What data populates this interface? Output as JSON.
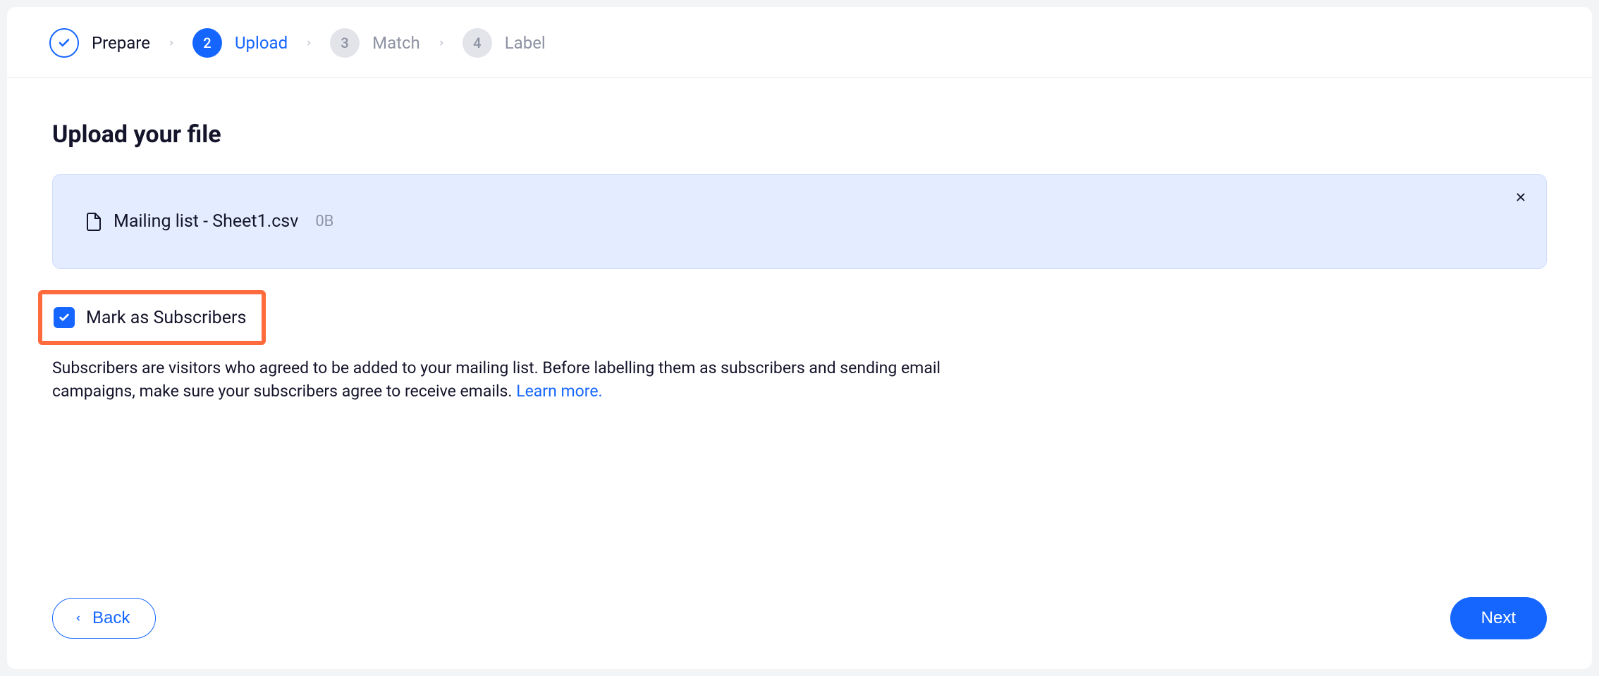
{
  "stepper": {
    "steps": [
      {
        "num": "",
        "label": "Prepare",
        "state": "done"
      },
      {
        "num": "2",
        "label": "Upload",
        "state": "active"
      },
      {
        "num": "3",
        "label": "Match",
        "state": "future"
      },
      {
        "num": "4",
        "label": "Label",
        "state": "future"
      }
    ]
  },
  "page": {
    "title": "Upload your file"
  },
  "file": {
    "name": "Mailing list - Sheet1.csv",
    "size": "0B"
  },
  "subscriberCheckbox": {
    "checked": true,
    "label": "Mark as Subscribers"
  },
  "description": {
    "text": "Subscribers are visitors who agreed to be added to your mailing list. Before labelling them as subscribers and sending email campaigns, make sure your subscribers agree to receive emails. ",
    "linkText": "Learn more."
  },
  "buttons": {
    "back": "Back",
    "next": "Next"
  }
}
